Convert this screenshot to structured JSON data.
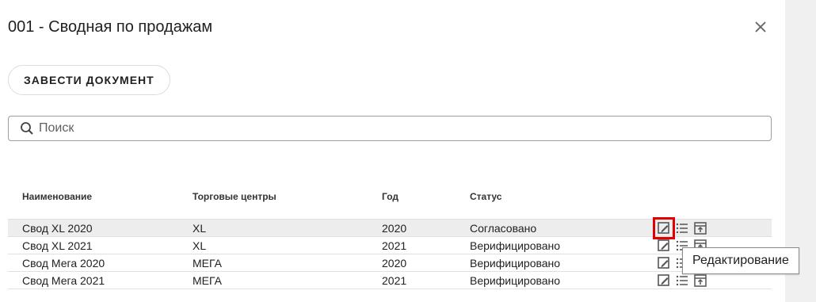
{
  "dialog": {
    "title": "001 - Сводная по продажам",
    "close_icon": "close-icon"
  },
  "toolbar": {
    "create_label": "ЗАВЕСТИ ДОКУМЕНТ"
  },
  "search": {
    "placeholder": "Поиск",
    "value": "",
    "icon": "search-icon"
  },
  "table": {
    "columns": [
      "Наименование",
      "Торговые центры",
      "Год",
      "Статус"
    ],
    "rows": [
      {
        "name": "Свод XL 2020",
        "centers": "XL",
        "year": "2020",
        "status": "Согласовано",
        "selected": true
      },
      {
        "name": "Свод XL 2021",
        "centers": "XL",
        "year": "2021",
        "status": "Верифицировано",
        "selected": false
      },
      {
        "name": "Свод Мега 2020",
        "centers": "МЕГА",
        "year": "2020",
        "status": "Верифицировано",
        "selected": false
      },
      {
        "name": "Свод Мега 2021",
        "centers": "МЕГА",
        "year": "2021",
        "status": "Верифицировано",
        "selected": false
      }
    ],
    "row_actions": [
      "edit-icon",
      "list-icon",
      "archive-icon"
    ]
  },
  "tooltip": {
    "text": "Редактирование"
  },
  "colors": {
    "highlight": "#e00000",
    "selected_row": "#ededed",
    "side_panel": "#f0f0f0"
  }
}
